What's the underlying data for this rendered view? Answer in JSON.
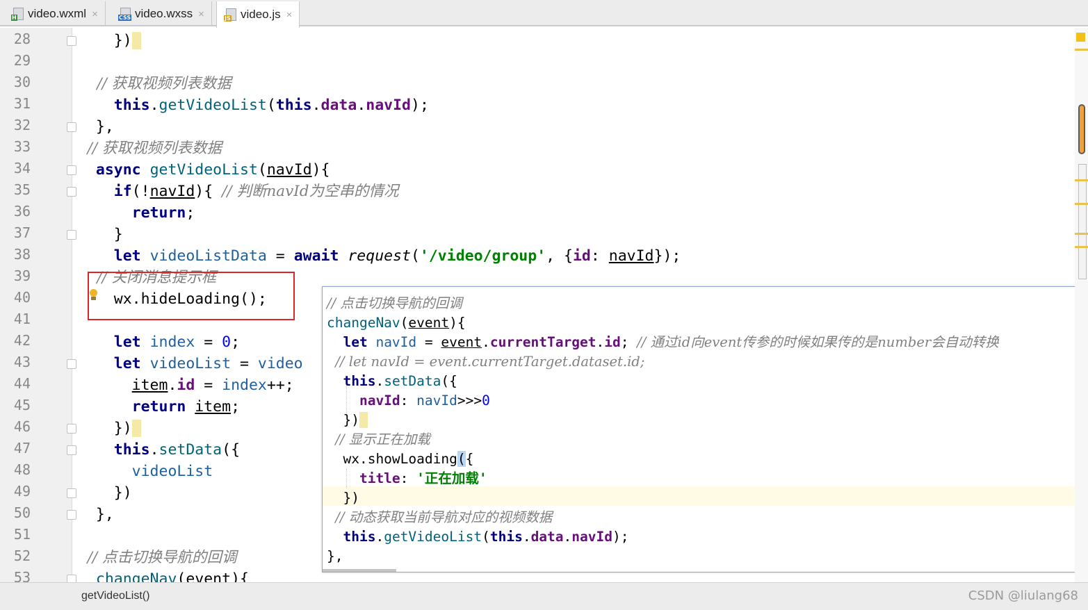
{
  "tabs": [
    {
      "label": "video.wxml",
      "icon": "wxml-file-icon",
      "badge": "H",
      "badge_color": "#3c8d3c"
    },
    {
      "label": "video.wxss",
      "icon": "wxss-file-icon",
      "badge": "CSS",
      "badge_color": "#2a6fc2"
    },
    {
      "label": "video.js",
      "icon": "js-file-icon",
      "badge": "JS",
      "badge_color": "#d0a020",
      "active": true
    }
  ],
  "gutter": {
    "lines": [
      "28",
      "29",
      "30",
      "31",
      "32",
      "33",
      "34",
      "35",
      "36",
      "37",
      "38",
      "39",
      "40",
      "41",
      "42",
      "43",
      "44",
      "45",
      "46",
      "47",
      "48",
      "49",
      "50",
      "51",
      "52",
      "53"
    ]
  },
  "code": {
    "l28": {
      "a": "    })"
    },
    "l30": {
      "a": "    // 获取视频列表数据"
    },
    "l31": {
      "a": "    this",
      "b": ".",
      "c": "getVideoList",
      "d": "(",
      "e": "this",
      "f": ".",
      "g": "data",
      "h": ".",
      "i": "navId",
      "j": ");"
    },
    "l32": {
      "a": "  },"
    },
    "l33": {
      "a": "  // 获取视频列表数据"
    },
    "l34": {
      "a": "  async ",
      "b": "getVideoList",
      "c": "(",
      "d": "navId",
      "e": "){"
    },
    "l35": {
      "a": "    if",
      "b": "(!",
      "c": "navId",
      "d": "){ ",
      "e": "// 判断navId为空串的情况"
    },
    "l36": {
      "a": "      return",
      "b": ";"
    },
    "l37": {
      "a": "    }"
    },
    "l38": {
      "a": "    let ",
      "b": "videoListData",
      "c": " = ",
      "d": "await ",
      "e": "request",
      "f": "(",
      "g": "'/video/group'",
      "h": ", {",
      "i": "id",
      "j": ": ",
      "k": "navId",
      "l": "});"
    },
    "l39": {
      "a": "    // 关闭消息提示框"
    },
    "l40": {
      "a": "    wx.hideLoading();"
    },
    "l42": {
      "a": "    let ",
      "b": "index",
      "c": " = ",
      "d": "0",
      "e": ";"
    },
    "l43": {
      "a": "    let ",
      "b": "videoList",
      "c": " = ",
      "d": "video"
    },
    "l44": {
      "a": "      ",
      "b": "item",
      "c": ".",
      "d": "id",
      "e": " = ",
      "f": "index",
      "g": "++;"
    },
    "l45": {
      "a": "      return ",
      "b": "item",
      "c": ";"
    },
    "l46": {
      "a": "    })"
    },
    "l47": {
      "a": "    this",
      "b": ".",
      "c": "setData",
      "d": "({"
    },
    "l48": {
      "a": "      videoList"
    },
    "l49": {
      "a": "    })"
    },
    "l50": {
      "a": "  },"
    },
    "l52": {
      "a": "  // 点击切换导航的回调"
    },
    "l53": {
      "a": "  changeNav",
      "b": "(",
      "c": "event",
      "d": "){"
    }
  },
  "popup": {
    "p1": {
      "a": "// 点击切换导航的回调"
    },
    "p2": {
      "a": "changeNav",
      "b": "(",
      "c": "event",
      "d": "){"
    },
    "p3": {
      "a": "  let ",
      "b": "navId",
      "c": " = ",
      "d": "event",
      "e": ".",
      "f": "currentTarget",
      "g": ".",
      "h": "id",
      "i": "; ",
      "j": "// 通过id向event传参的时候如果传的是number会自动转换"
    },
    "p4": {
      "a": "  // let navId = event.currentTarget.dataset.id;"
    },
    "p5": {
      "a": "  this",
      "b": ".",
      "c": "setData",
      "d": "({"
    },
    "p6": {
      "a": "    navId",
      "b": ": ",
      "c": "navId",
      "d": ">>>",
      "e": "0"
    },
    "p7": {
      "a": "  })"
    },
    "p8": {
      "a": "  // 显示正在加载"
    },
    "p9": {
      "a": "  wx.",
      "b": "showLoading",
      "c": "(",
      "d": "{"
    },
    "p10": {
      "a": "    title",
      "b": ": ",
      "c": "'正在加载'"
    },
    "p11": {
      "a": "  })"
    },
    "p12": {
      "a": "  // 动态获取当前导航对应的视频数据"
    },
    "p13": {
      "a": "  this",
      "b": ".",
      "c": "getVideoList",
      "d": "(",
      "e": "this",
      "f": ".",
      "g": "data",
      "h": ".",
      "i": "navId",
      "j": ");"
    },
    "p14": {
      "a": "},"
    }
  },
  "status": {
    "breadcrumb": "getVideoList()",
    "watermark": "CSDN @liulang68"
  },
  "colors": {
    "keyword": "#000080",
    "string": "#008000",
    "comment": "#808080",
    "highlight_box": "#d9262b"
  }
}
